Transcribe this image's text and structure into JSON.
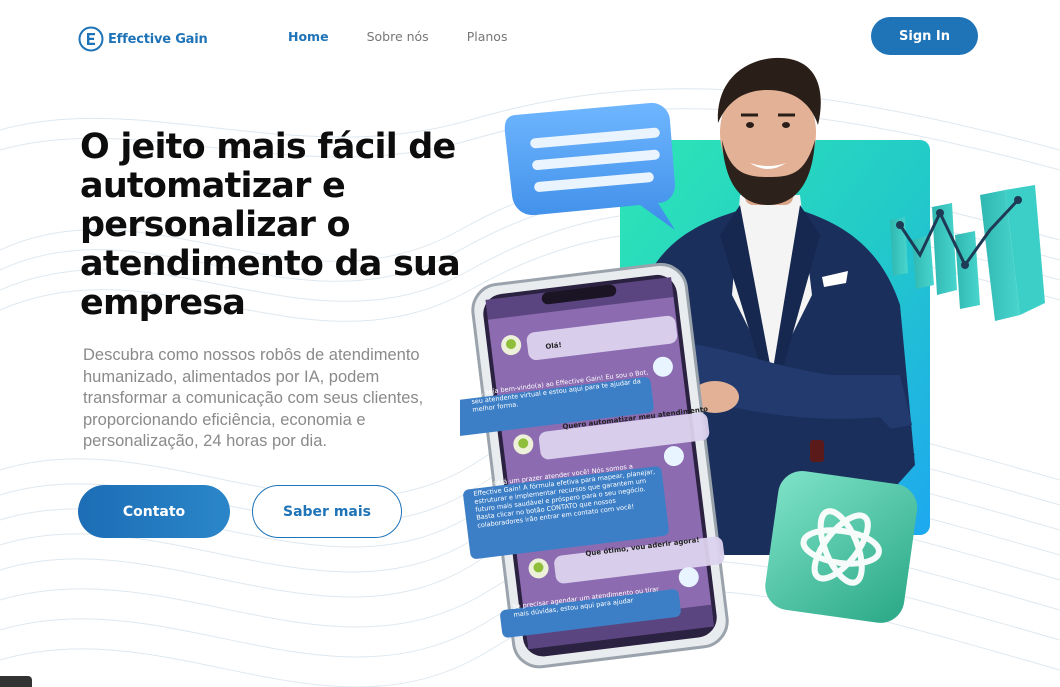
{
  "brand": {
    "name": "Effective Gain",
    "logo_icon": "letter-e-circle-icon",
    "accent": "#1f73b7"
  },
  "nav": {
    "items": [
      {
        "label": "Home",
        "active": true
      },
      {
        "label": "Sobre nós",
        "active": false
      },
      {
        "label": "Planos",
        "active": false
      }
    ]
  },
  "header": {
    "signin_label": "Sign In"
  },
  "hero": {
    "headline": "O jeito mais fácil de automatizar e personalizar o atendimento da sua empresa",
    "subtext": "Descubra como nossos robôs de atendimento humanizado, alimentados por IA, podem transformar a comunicação com seus clientes, proporcionando eficiência, economia e personalização, 24 horas por dia.",
    "primary_button": "Contato",
    "secondary_button": "Saber mais"
  },
  "chat": {
    "messages": [
      {
        "from": "user",
        "text": "Olá!"
      },
      {
        "from": "bot",
        "text": "Olá, seja bem-vindo(a) ao Effective Gain! Eu sou o Bot, seu atendente virtual e estou aqui para te ajudar da melhor forma."
      },
      {
        "from": "user",
        "text": "Quero automatizar meu atendimento"
      },
      {
        "from": "bot",
        "text": "Claro, será um prazer atender você! Nós somos a Effective Gain! A fórmula efetiva para mapear, planejar, estruturar e implementar recursos que garantem um futuro mais saudável e próspero para o seu negócio. Basta clicar no botão CONTATO que nossos colaboradores irão entrar em contato com você!"
      },
      {
        "from": "user",
        "text": "Que ótimo, vou aderir agora!"
      },
      {
        "from": "bot",
        "text": "Se precisar agendar um atendimento ou tirar mais dúvidas, estou aqui para ajudar"
      }
    ]
  },
  "colors": {
    "brand_blue": "#1f73b7",
    "teal": "#2ec4a6",
    "chat_purple": "#8c6bb1"
  }
}
